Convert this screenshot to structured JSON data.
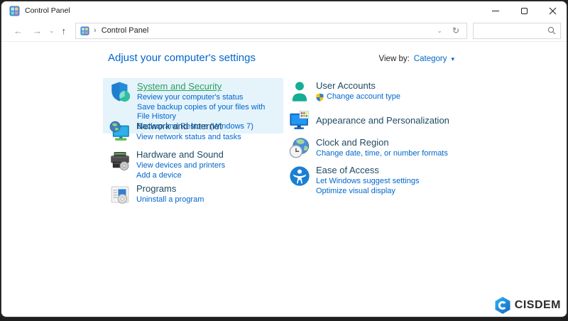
{
  "window": {
    "title": "Control Panel"
  },
  "nav": {
    "back_glyph": "←",
    "forward_glyph": "→",
    "history_dropdown_glyph": "⌄",
    "up_glyph": "↑",
    "address": {
      "chevron": "›",
      "location": "Control Panel",
      "dropdown_glyph": "⌄",
      "refresh_glyph": "↻"
    },
    "search": {
      "value": "",
      "placeholder": ""
    }
  },
  "header": {
    "title": "Adjust your computer's settings",
    "view_by_label": "View by:",
    "view_by_value": "Category",
    "view_by_caret": "▾"
  },
  "categories": {
    "left": [
      {
        "icon": "security-shield-icon",
        "title": "System and Security",
        "hovered": true,
        "links": [
          "Review your computer's status",
          "Save backup copies of your files with File History",
          "Backup and Restore (Windows 7)"
        ]
      },
      {
        "icon": "network-monitor-globe-icon",
        "title": "Network and Internet",
        "links": [
          "View network status and tasks"
        ]
      },
      {
        "icon": "printer-icon",
        "title": "Hardware and Sound",
        "links": [
          "View devices and printers",
          "Add a device"
        ]
      },
      {
        "icon": "programs-window-disc-icon",
        "title": "Programs",
        "links": [
          "Uninstall a program"
        ]
      }
    ],
    "right": [
      {
        "icon": "user-silhouette-icon",
        "title": "User Accounts",
        "links": [
          "Change account type"
        ],
        "link_badge": "uac-shield-icon"
      },
      {
        "icon": "monitor-personalization-icon",
        "title": "Appearance and Personalization",
        "links": []
      },
      {
        "icon": "globe-clock-icon",
        "title": "Clock and Region",
        "links": [
          "Change date, time, or number formats"
        ]
      },
      {
        "icon": "accessibility-person-icon",
        "title": "Ease of Access",
        "links": [
          "Let Windows suggest settings",
          "Optimize visual display"
        ]
      }
    ]
  },
  "watermark": {
    "brand": "CISDEM"
  },
  "colors": {
    "link_blue": "#0066cc",
    "category_title": "#1e4962",
    "hover_green": "#2ba15e",
    "highlight_bg": "#e5f3fb"
  }
}
